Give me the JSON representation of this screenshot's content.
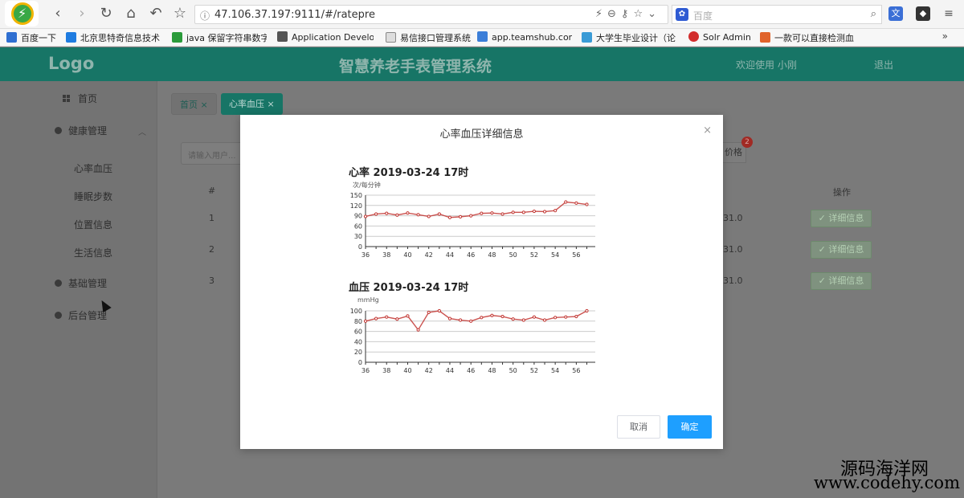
{
  "browser": {
    "url_prefix": "ⓘ",
    "url": "47.106.37.197:9111/#/ratepre",
    "search_placeholder": "百度",
    "bookmarks": [
      {
        "label": "百度一下",
        "color": "#2f6fd1"
      },
      {
        "label": "北京思特奇信息技术",
        "color": "#1f7ce0"
      },
      {
        "label": "java 保留字符串数字",
        "color": "#2b9b3b"
      },
      {
        "label": "Application Develo",
        "color": "#555555"
      },
      {
        "label": "易信接口管理系统",
        "color": "#888888"
      },
      {
        "label": "app.teamshub.com",
        "color": "#3b7ed8"
      },
      {
        "label": "大学生毕业设计（论",
        "color": "#3a9bd6"
      },
      {
        "label": "Solr Admin",
        "color": "#d22d2d"
      },
      {
        "label": "一款可以直接检测血",
        "color": "#e0632b"
      }
    ],
    "more": "»"
  },
  "app": {
    "logo": "Logo",
    "title": "智慧养老手表管理系统",
    "welcome": "欢迎使用 小刚",
    "logout": "退出"
  },
  "sidebar": {
    "home": "首页",
    "health": "健康管理",
    "items": [
      "心率血压",
      "睡眠步数",
      "位置信息",
      "生活信息"
    ],
    "basic": "基础管理",
    "backend": "后台管理"
  },
  "tabs": [
    {
      "label": "首页 ×"
    },
    {
      "label": "心率血压 ×"
    }
  ],
  "background": {
    "search_placeholder": "请输入用户...",
    "button": "价格",
    "badge": "2",
    "col_index": "#",
    "col_op": "操作",
    "rows": [
      {
        "index": "1",
        "value": "31.0",
        "op": "✓ 详细信息"
      },
      {
        "index": "2",
        "value": "31.0",
        "op": "✓ 详细信息"
      },
      {
        "index": "3",
        "value": "31.0",
        "op": "✓ 详细信息"
      }
    ]
  },
  "modal": {
    "title": "心率血压详细信息",
    "close": "×",
    "cancel": "取消",
    "ok": "确定"
  },
  "watermark": {
    "line1": "源码海洋网",
    "line2": "www.codehy.com"
  },
  "chart_data": [
    {
      "type": "line",
      "title": "心率  2019-03-24 17时",
      "ylabel": "次/每分钟",
      "x": [
        36,
        37,
        38,
        39,
        40,
        41,
        42,
        43,
        44,
        45,
        46,
        47,
        48,
        49,
        50,
        51,
        52,
        53,
        54,
        55,
        56,
        57
      ],
      "xticks": [
        "36",
        "38",
        "40",
        "42",
        "44",
        "46",
        "48",
        "50",
        "52",
        "54",
        "56"
      ],
      "yticks": [
        "0",
        "30",
        "60",
        "90",
        "120",
        "150"
      ],
      "ylim": [
        0,
        150
      ],
      "series": [
        {
          "values": [
            88,
            95,
            97,
            92,
            98,
            93,
            88,
            95,
            85,
            87,
            90,
            97,
            98,
            95,
            100,
            100,
            103,
            102,
            105,
            130,
            127,
            123
          ]
        }
      ],
      "grid": true,
      "color": "#c23531"
    },
    {
      "type": "line",
      "title": "血压  2019-03-24 17时",
      "ylabel": "mmHg",
      "x": [
        36,
        37,
        38,
        39,
        40,
        41,
        42,
        43,
        44,
        45,
        46,
        47,
        48,
        49,
        50,
        51,
        52,
        53,
        54,
        55,
        56,
        57
      ],
      "xticks": [
        "36",
        "38",
        "40",
        "42",
        "44",
        "46",
        "48",
        "50",
        "52",
        "54",
        "56"
      ],
      "yticks": [
        "0",
        "20",
        "40",
        "60",
        "80",
        "100"
      ],
      "ylim": [
        0,
        100
      ],
      "series": [
        {
          "values": [
            80,
            85,
            88,
            84,
            90,
            63,
            97,
            100,
            85,
            82,
            80,
            87,
            91,
            89,
            84,
            82,
            88,
            82,
            87,
            88,
            89,
            100
          ]
        }
      ],
      "grid": true,
      "color": "#c23531"
    }
  ]
}
